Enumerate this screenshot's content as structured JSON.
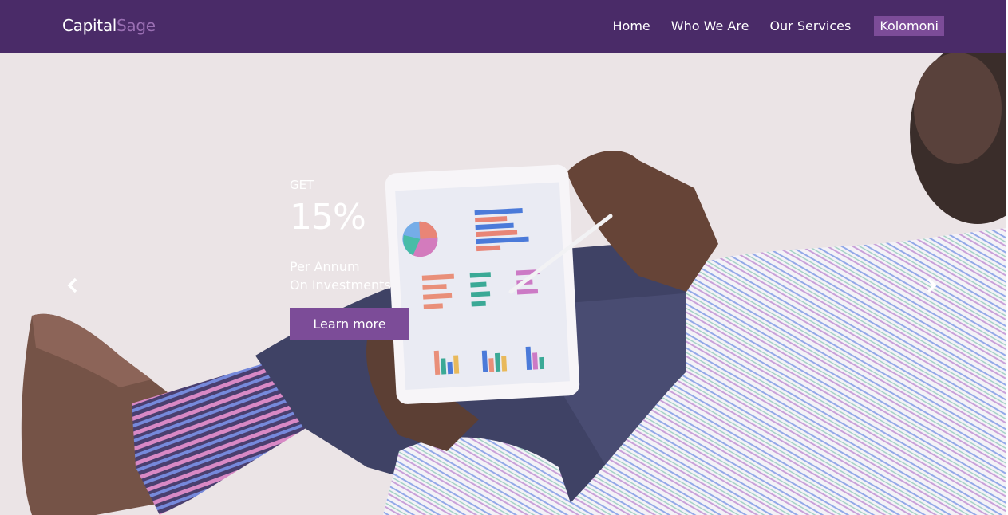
{
  "brand": {
    "part1": "Capital",
    "part2": "Sage"
  },
  "nav": {
    "items": [
      {
        "label": "Home"
      },
      {
        "label": "Who We Are"
      },
      {
        "label": "Our Services"
      },
      {
        "label": "Kolomoni"
      }
    ],
    "active_index": 3
  },
  "hero": {
    "kicker": "GET",
    "headline": "15%",
    "line1": "Per Annum",
    "line2": "On Investments",
    "cta_label": "Learn more",
    "prev_icon": "chevron-left-icon",
    "next_icon": "chevron-right-icon"
  },
  "colors": {
    "nav_bg": "#4a2b68",
    "accent": "#7c4c98",
    "brand_secondary": "#9a6fb3"
  }
}
